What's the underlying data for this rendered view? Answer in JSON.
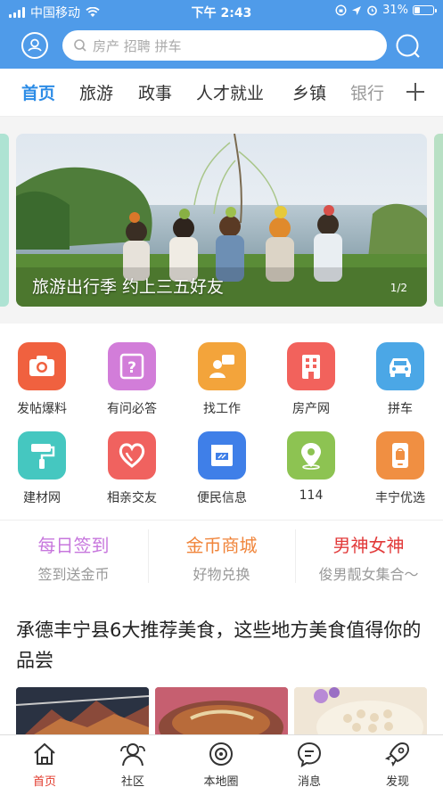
{
  "status": {
    "carrier": "中国移动",
    "time": "下午 2:43",
    "battery": "31%",
    "battery_level": 0.31
  },
  "header": {
    "search_placeholder": "房产 招聘  拼车"
  },
  "tabs": [
    {
      "label": "首页",
      "active": true
    },
    {
      "label": "旅游"
    },
    {
      "label": "政事"
    },
    {
      "label": "人才就业"
    },
    {
      "label": "乡镇"
    },
    {
      "label": "银行"
    }
  ],
  "banner": {
    "title": "旅游出行季 约上三五好友",
    "page": "1/2"
  },
  "grid": [
    {
      "label": "发帖爆料",
      "icon": "camera-icon",
      "color": "#f0613f"
    },
    {
      "label": "有问必答",
      "icon": "question-icon",
      "color": "#d27dd9"
    },
    {
      "label": "找工作",
      "icon": "job-icon",
      "color": "#f3a43b"
    },
    {
      "label": "房产网",
      "icon": "building-icon",
      "color": "#f2625c"
    },
    {
      "label": "拼车",
      "icon": "car-icon",
      "color": "#4ba7e6"
    },
    {
      "label": "建材网",
      "icon": "paint-roller-icon",
      "color": "#45c7c0"
    },
    {
      "label": "相亲交友",
      "icon": "heart-icon",
      "color": "#f0625f"
    },
    {
      "label": "便民信息",
      "icon": "store-icon",
      "color": "#3f7fe8"
    },
    {
      "label": "114",
      "icon": "location-icon",
      "color": "#8dc352"
    },
    {
      "label": "丰宁优选",
      "icon": "phone-bag-icon",
      "color": "#f08f42"
    }
  ],
  "features": [
    {
      "title": "每日签到",
      "sub": "签到送金币",
      "color": "#c777dd"
    },
    {
      "title": "金币商城",
      "sub": "好物兑换",
      "color": "#f0843a"
    },
    {
      "title": "男神女神",
      "sub": "俊男靓女集合～",
      "color": "#e23b3b"
    }
  ],
  "article": {
    "title": "承德丰宁县6大推荐美食，这些地方美食值得你的品尝"
  },
  "bottom_nav": [
    {
      "label": "首页",
      "icon": "home-icon",
      "active": true
    },
    {
      "label": "社区",
      "icon": "community-icon"
    },
    {
      "label": "本地圈",
      "icon": "local-circle-icon"
    },
    {
      "label": "消息",
      "icon": "message-icon"
    },
    {
      "label": "发现",
      "icon": "rocket-icon"
    }
  ],
  "colors": {
    "header_blue": "#4f9be9",
    "active_tab": "#2d8ce6",
    "nav_active": "#e23b2d"
  }
}
